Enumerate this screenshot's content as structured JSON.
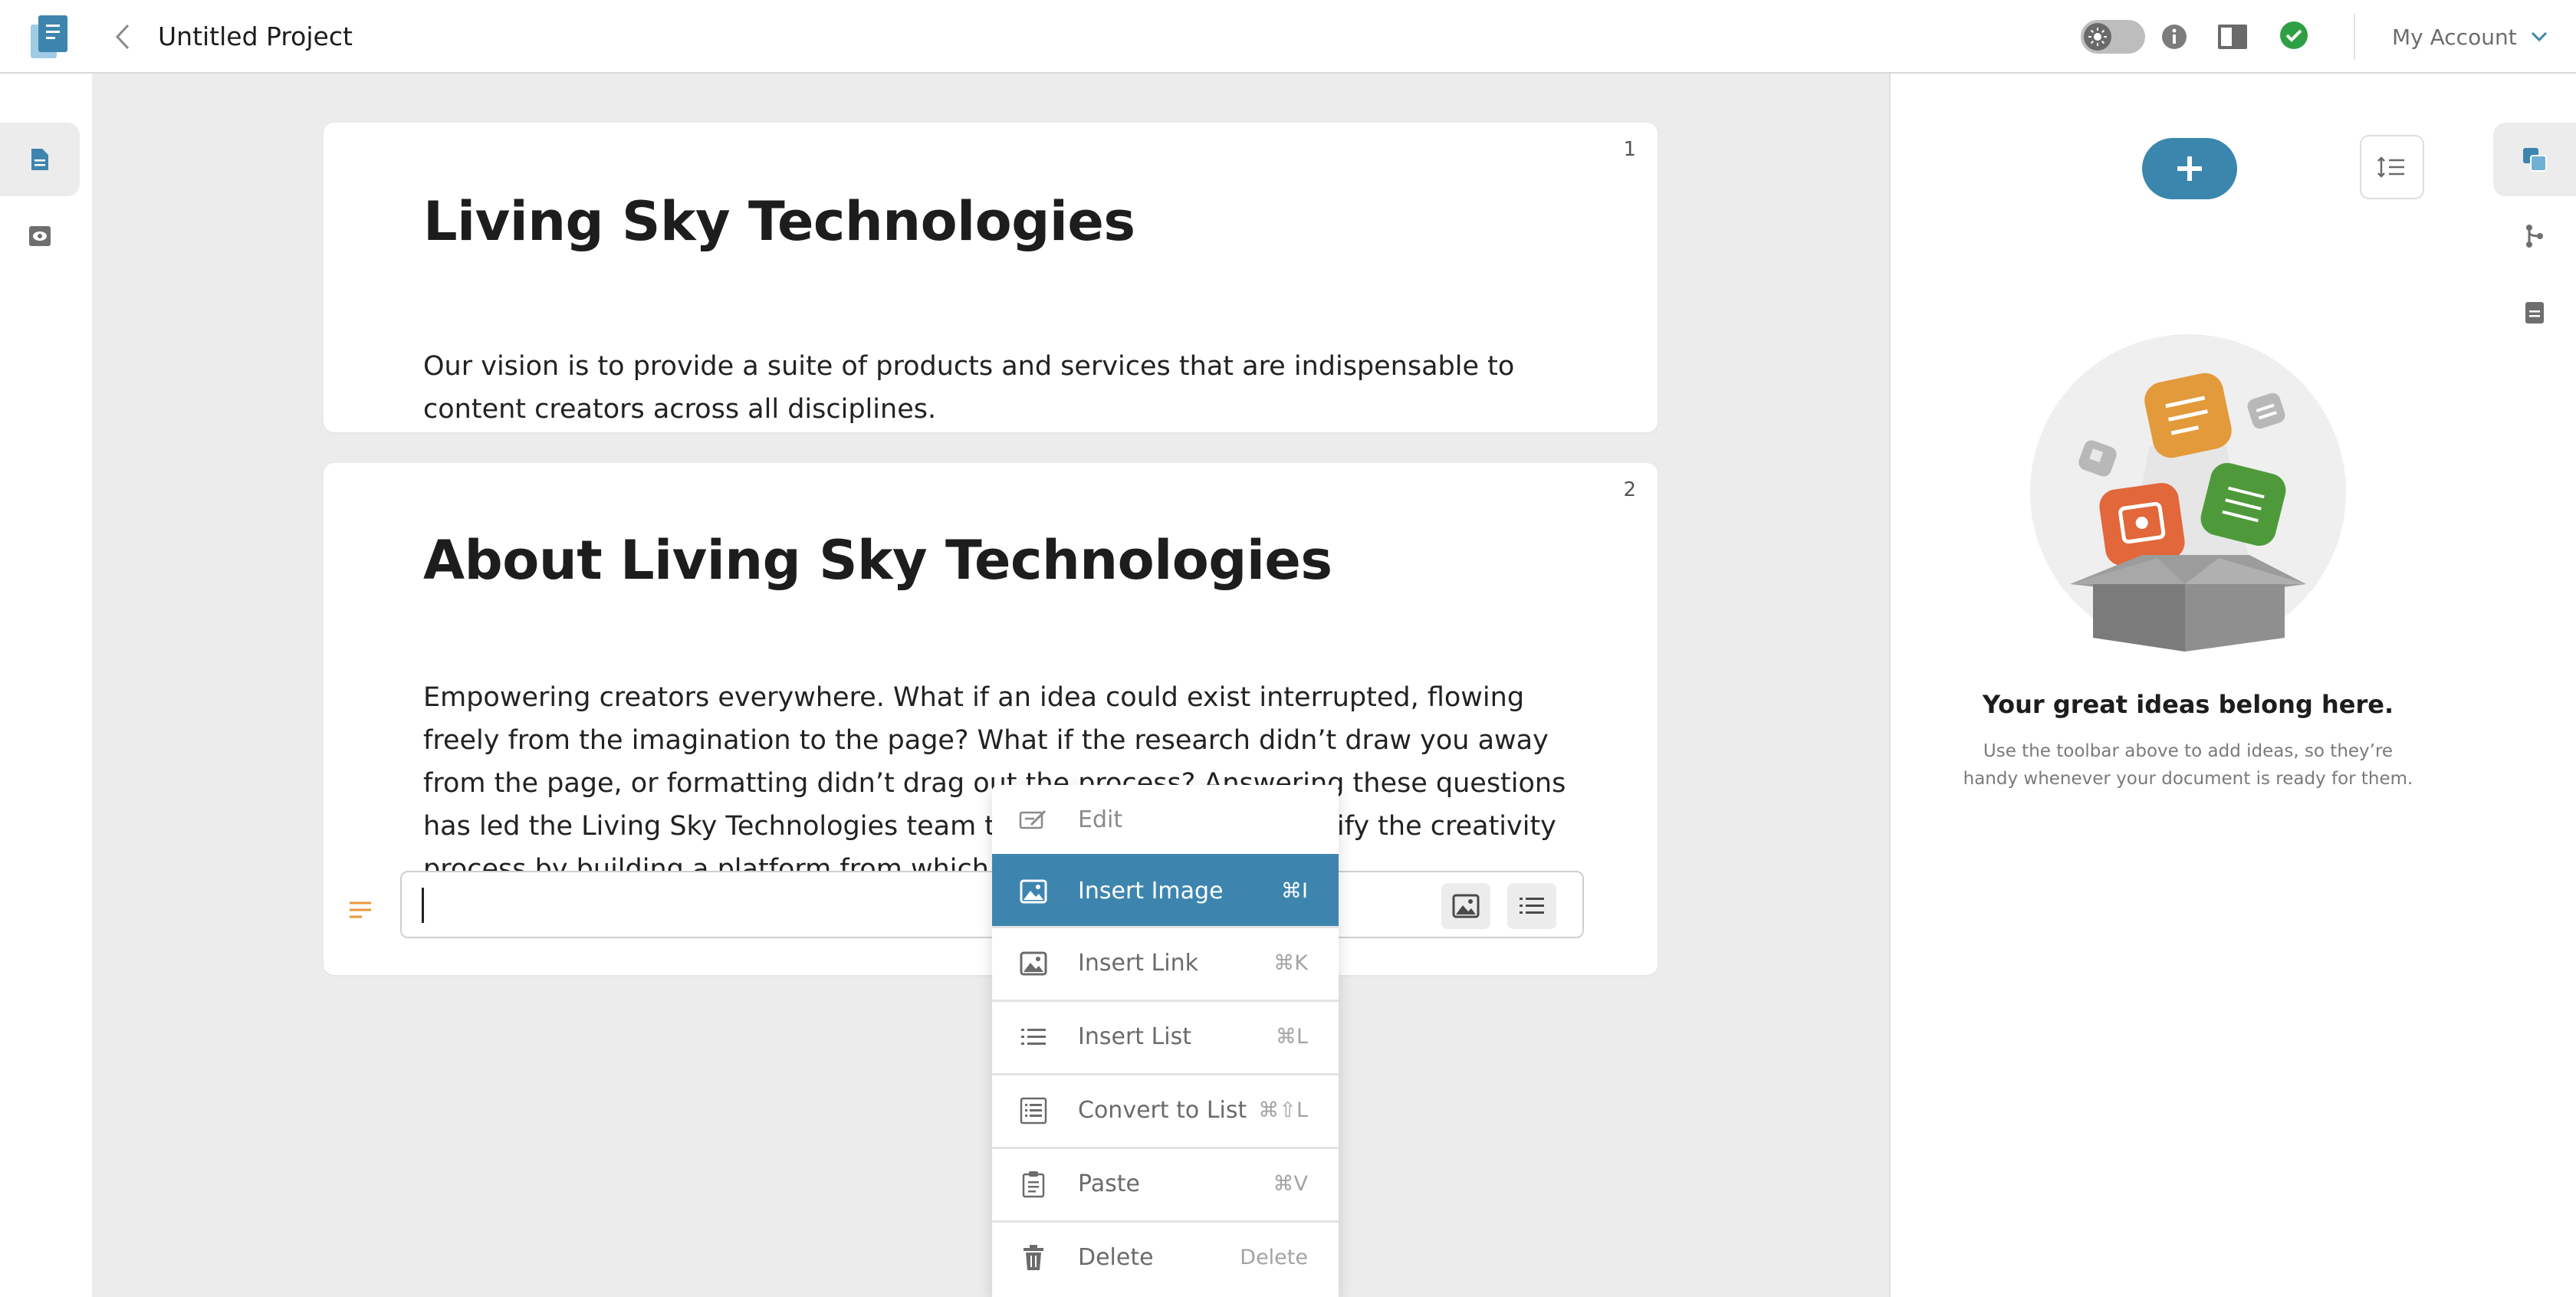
{
  "header": {
    "project_title": "Untitled Project",
    "account_label": "My Account"
  },
  "left_rail": {
    "items": [
      {
        "icon": "document-icon",
        "active": true
      },
      {
        "icon": "eye-icon",
        "active": false
      }
    ]
  },
  "document": {
    "cards": [
      {
        "number": "1",
        "title": "Living Sky Technologies",
        "body": "Our vision is to provide a suite of products and services that are indispensable to content creators across all disciplines."
      },
      {
        "number": "2",
        "title": "About Living Sky Technologies",
        "body": "Empowering creators everywhere. What if an idea could exist interrupted, flowing freely from the imagination to the page? What if the research didn’t draw you away from the page, or formatting didn’t drag out the process? Answering these questions has led the Living Sky Technologies team to discover a way to simplify the creativity process by building a platform from which any content c"
      }
    ]
  },
  "context_menu": {
    "items": [
      {
        "icon": "edit-icon",
        "label": "Edit",
        "shortcut": ""
      },
      {
        "icon": "image-icon",
        "label": "Insert Image",
        "shortcut": "⌘I",
        "highlighted": true
      },
      {
        "icon": "image-icon",
        "label": "Insert Link",
        "shortcut": "⌘K"
      },
      {
        "icon": "list-icon",
        "label": "Insert List",
        "shortcut": "⌘L"
      },
      {
        "icon": "convert-list-icon",
        "label": "Convert to List",
        "shortcut": "⌘⇧L"
      },
      {
        "icon": "clipboard-icon",
        "label": "Paste",
        "shortcut": "⌘V"
      },
      {
        "icon": "trash-icon",
        "label": "Delete",
        "shortcut": "Delete"
      }
    ]
  },
  "ideas_panel": {
    "empty_title": "Your great ideas belong here.",
    "empty_description": "Use the toolbar above to add ideas, so they’re handy whenever your document is ready for them."
  },
  "colors": {
    "accent": "#3d85ae",
    "success": "#2ea043",
    "handle": "#e8973a"
  }
}
